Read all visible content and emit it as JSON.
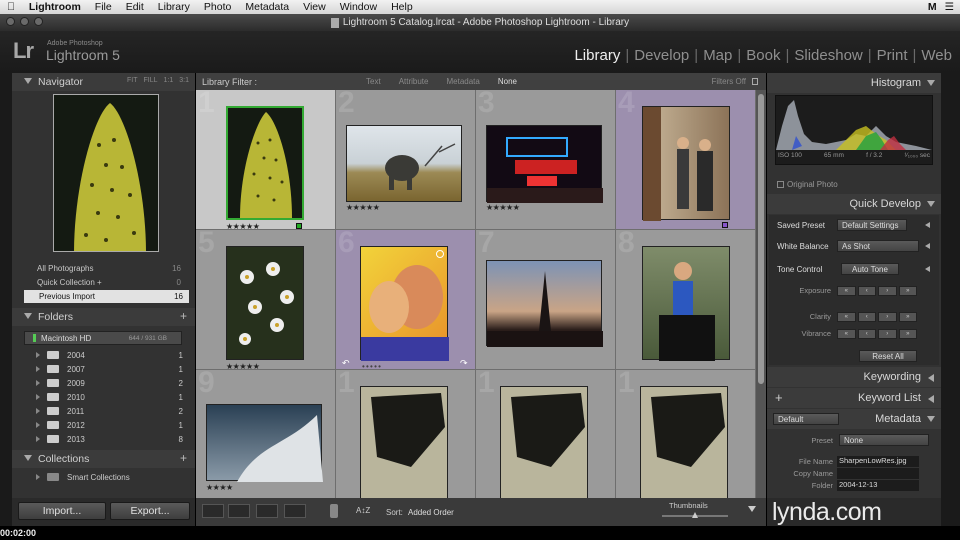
{
  "menubar": {
    "apple": "",
    "items": [
      "Lightroom",
      "File",
      "Edit",
      "Library",
      "Photo",
      "Metadata",
      "View",
      "Window",
      "Help"
    ],
    "right_badge": "M"
  },
  "window": {
    "title": "Lightroom 5 Catalog.lrcat - Adobe Photoshop Lightroom - Library"
  },
  "logo": {
    "mark": "Lr",
    "sub1": "Adobe Photoshop",
    "sub2": "Lightroom 5"
  },
  "modules": [
    "Library",
    "Develop",
    "Map",
    "Book",
    "Slideshow",
    "Print",
    "Web"
  ],
  "navigator": {
    "title": "Navigator",
    "opts": [
      "FIT",
      "FILL",
      "1:1",
      "3:1"
    ]
  },
  "catalog": {
    "rows": [
      {
        "label": "All Photographs",
        "count": "16"
      },
      {
        "label": "Quick Collection +",
        "count": "0"
      },
      {
        "label": "Previous Import",
        "count": "16"
      }
    ]
  },
  "folders": {
    "title": "Folders",
    "drive": {
      "name": "Macintosh HD",
      "capacity": "644 / 931 GB"
    },
    "items": [
      {
        "name": "2004",
        "count": "1"
      },
      {
        "name": "2007",
        "count": "1"
      },
      {
        "name": "2009",
        "count": "2"
      },
      {
        "name": "2010",
        "count": "1"
      },
      {
        "name": "2011",
        "count": "2"
      },
      {
        "name": "2012",
        "count": "1"
      },
      {
        "name": "2013",
        "count": "8"
      }
    ]
  },
  "collections": {
    "title": "Collections",
    "smart": "Smart Collections"
  },
  "buttons": {
    "import": "Import...",
    "export": "Export..."
  },
  "filter": {
    "label": "Library Filter :",
    "items": [
      "Text",
      "Attribute",
      "Metadata",
      "None"
    ],
    "status": "Filters Off"
  },
  "grid": {
    "cells": [
      {
        "num": "1",
        "stars": "★★★★★"
      },
      {
        "num": "2",
        "stars": "★★★★★"
      },
      {
        "num": "3",
        "stars": "★★★★★"
      },
      {
        "num": "4",
        "stars": ""
      },
      {
        "num": "5",
        "stars": "★★★★★"
      },
      {
        "num": "6",
        "stars": "• • • • •"
      },
      {
        "num": "7",
        "stars": ""
      },
      {
        "num": "8",
        "stars": ""
      },
      {
        "num": "9",
        "stars": "★★★★"
      },
      {
        "num": "1",
        "stars": ""
      },
      {
        "num": "1",
        "stars": ""
      },
      {
        "num": "1",
        "stars": ""
      }
    ]
  },
  "toolbar": {
    "sort_label": "Sort:",
    "sort_value": "Added Order",
    "thumbs_label": "Thumbnails"
  },
  "histogram": {
    "title": "Histogram",
    "iso": "ISO 100",
    "focal": "65 mm",
    "aperture": "f / 3.2",
    "shutter": "¹⁄₁₀₀₀ sec",
    "original": "Original Photo"
  },
  "quick_develop": {
    "title": "Quick Develop",
    "saved_preset_label": "Saved Preset",
    "saved_preset_value": "Default Settings",
    "wb_label": "White Balance",
    "wb_value": "As Shot",
    "tone_label": "Tone Control",
    "auto_tone": "Auto Tone",
    "sliders": [
      "Exposure",
      "Clarity",
      "Vibrance"
    ],
    "reset": "Reset All"
  },
  "keywording": {
    "title": "Keywording"
  },
  "keyword_list": {
    "title": "Keyword List"
  },
  "metadata": {
    "title": "Metadata",
    "default": "Default",
    "preset_label": "Preset",
    "preset_value": "None",
    "file_name_label": "File Name",
    "file_name_value": "SharpenLowRes.jpg",
    "copy_name_label": "Copy Name",
    "folder_label": "Folder",
    "folder_value": "2004-12-13"
  },
  "watermark": "lynda.com",
  "timecode": "00:02:00"
}
